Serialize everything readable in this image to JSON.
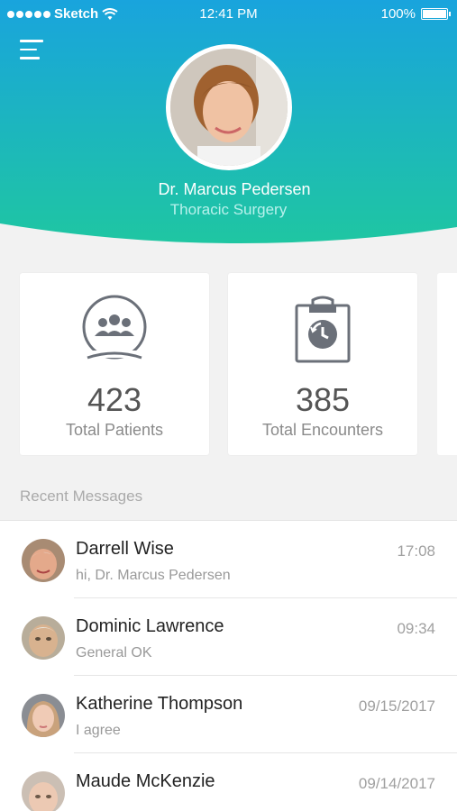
{
  "status_bar": {
    "carrier": "Sketch",
    "time": "12:41 PM",
    "battery": "100%"
  },
  "profile": {
    "name": "Dr. Marcus Pedersen",
    "department": "Thoracic Surgery"
  },
  "stats": [
    {
      "value": "423",
      "label": "Total Patients",
      "icon": "patients-group-icon"
    },
    {
      "value": "385",
      "label": "Total Encounters",
      "icon": "clipboard-history-icon"
    }
  ],
  "recent_messages": {
    "title": "Recent Messages",
    "items": [
      {
        "name": "Darrell Wise",
        "preview": "hi, Dr. Marcus Pedersen",
        "time": "17:08"
      },
      {
        "name": "Dominic Lawrence",
        "preview": "General OK",
        "time": "09:34"
      },
      {
        "name": "Katherine Thompson",
        "preview": "I agree",
        "time": "09/15/2017"
      },
      {
        "name": "Maude McKenzie",
        "preview": "",
        "time": "09/14/2017"
      }
    ]
  },
  "colors": {
    "gradient_top": "#1aa3d9",
    "gradient_bottom": "#1ec2a6",
    "icon_gray": "#6b7079"
  }
}
